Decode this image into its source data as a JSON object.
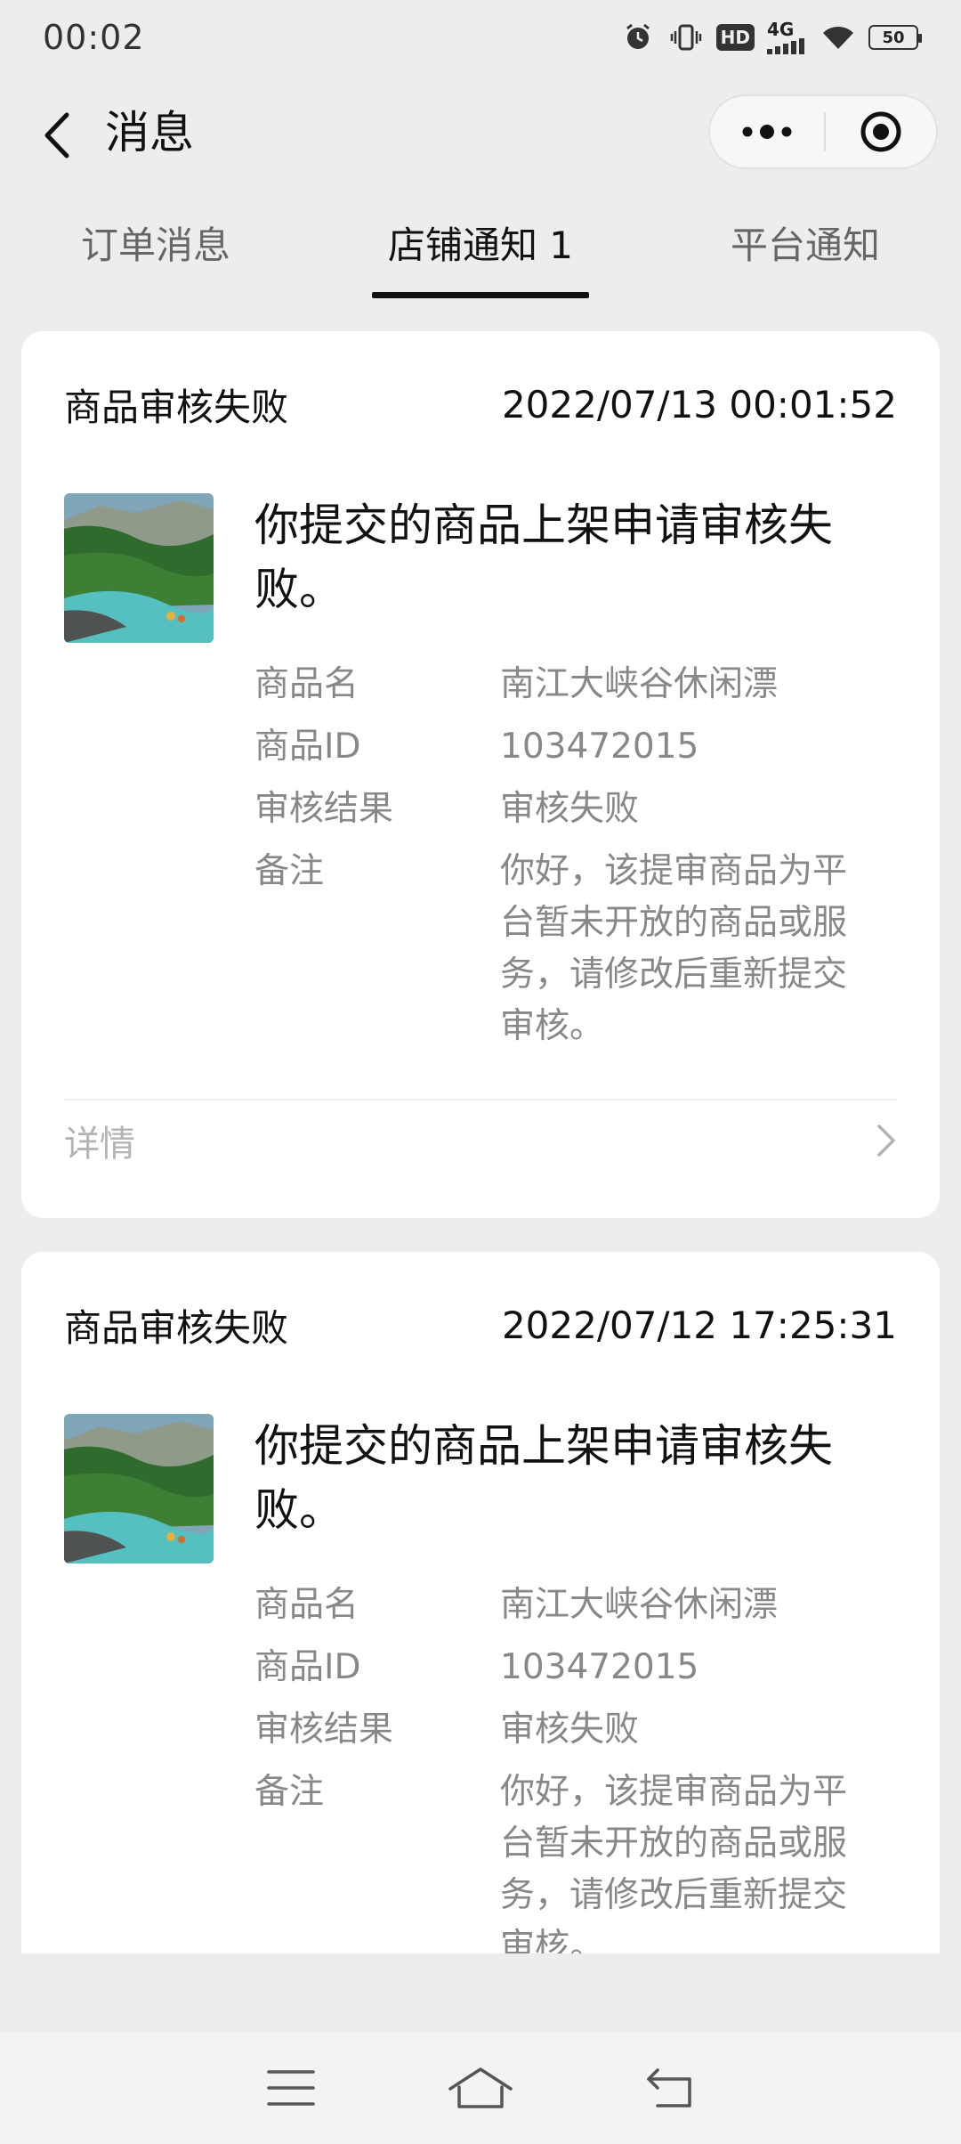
{
  "status_bar": {
    "time": "00:02",
    "hd": "HD",
    "network": "4G",
    "battery": "50"
  },
  "navbar": {
    "title": "消息"
  },
  "tabs": [
    {
      "label": "订单消息",
      "active": false
    },
    {
      "label": "店铺通知 1",
      "active": true
    },
    {
      "label": "平台通知",
      "active": false
    }
  ],
  "messages": [
    {
      "type": "商品审核失败",
      "time": "2022/07/13 00:01:52",
      "title": "你提交的商品上架申请审核失败。",
      "fields": [
        {
          "key": "商品名",
          "value": "南江大峡谷休闲漂"
        },
        {
          "key": "商品ID",
          "value": "103472015"
        },
        {
          "key": "审核结果",
          "value": "审核失败"
        },
        {
          "key": "备注",
          "value": "你好，该提审商品为平台暂未开放的商品或服务，请修改后重新提交审核。"
        }
      ],
      "detail_label": "详情"
    },
    {
      "type": "商品审核失败",
      "time": "2022/07/12 17:25:31",
      "title": "你提交的商品上架申请审核失败。",
      "fields": [
        {
          "key": "商品名",
          "value": "南江大峡谷休闲漂"
        },
        {
          "key": "商品ID",
          "value": "103472015"
        },
        {
          "key": "审核结果",
          "value": "审核失败"
        },
        {
          "key": "备注",
          "value": "你好，该提审商品为平台暂未开放的商品或服务，请修改后重新提交审核。"
        }
      ]
    }
  ],
  "colors": {
    "background": "#ededed",
    "card": "#ffffff",
    "primary_text": "#111111",
    "secondary_text": "#888888",
    "muted_text": "#b3b3b3"
  }
}
